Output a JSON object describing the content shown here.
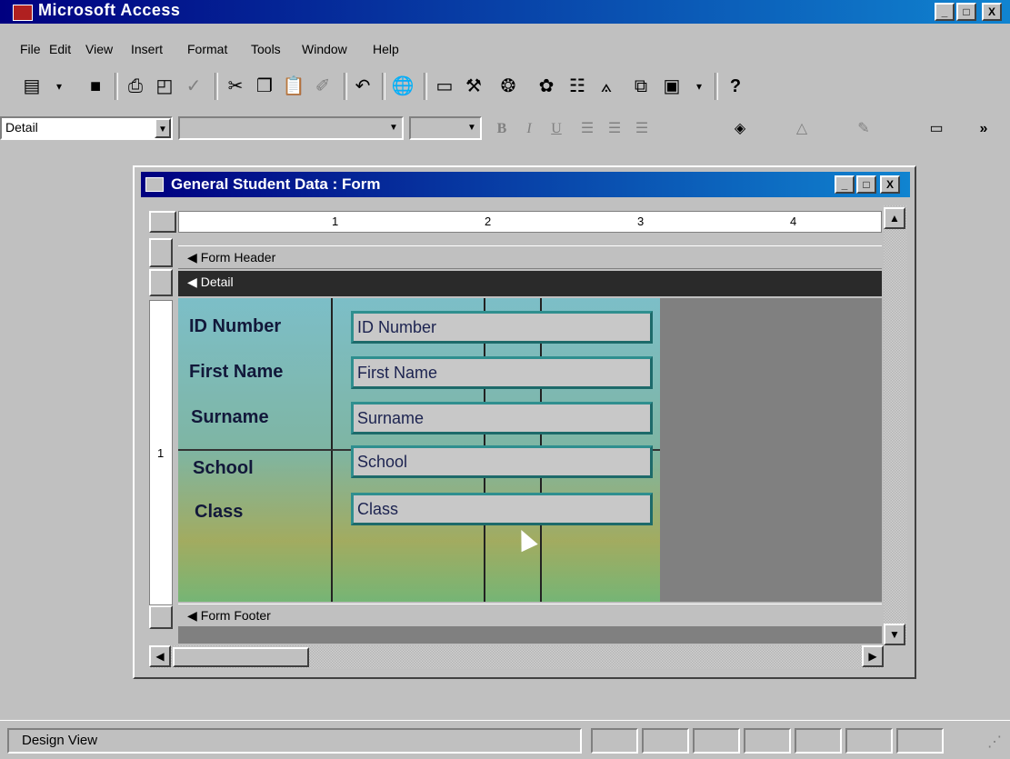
{
  "app": {
    "title": "Microsoft Access",
    "caption_buttons": [
      "_",
      "□",
      "X"
    ]
  },
  "menu": [
    "File",
    "Edit",
    "View",
    "Insert",
    "Format",
    "Tools",
    "Window",
    "Help"
  ],
  "toolbar_icons": [
    "view-icon",
    "save-icon",
    "print-icon",
    "print-preview-icon",
    "spelling-icon",
    "cut-icon",
    "copy-icon",
    "paste-icon",
    "format-painter-icon",
    "undo-icon",
    "insert-hyperlink-icon",
    "field-list-icon",
    "toolbox-icon",
    "autoformat-icon",
    "code-icon",
    "properties-icon",
    "build-icon",
    "database-window-icon",
    "new-object-icon",
    "help-icon"
  ],
  "format_toolbar": {
    "object_selector": "Detail",
    "font_name": "",
    "font_size": ""
  },
  "form_window": {
    "title": "General Student Data : Form",
    "sections": {
      "header": "Form Header",
      "detail": "Detail",
      "footer": "Form Footer"
    },
    "ruler_h_numbers": [
      "1",
      "2",
      "3",
      "4"
    ],
    "ruler_v_numbers": [
      "1"
    ],
    "fields": [
      {
        "label": "ID Number",
        "control": "ID Number"
      },
      {
        "label": "First Name",
        "control": "First Name"
      },
      {
        "label": "Surname",
        "control": "Surname"
      },
      {
        "label": "School",
        "control": "School"
      },
      {
        "label": "Class",
        "control": "Class"
      }
    ]
  },
  "status": {
    "text": "Design View"
  },
  "colors": {
    "titlebar": "#000080",
    "control_border": "#2f8f8f",
    "label_text": "#12183a"
  }
}
